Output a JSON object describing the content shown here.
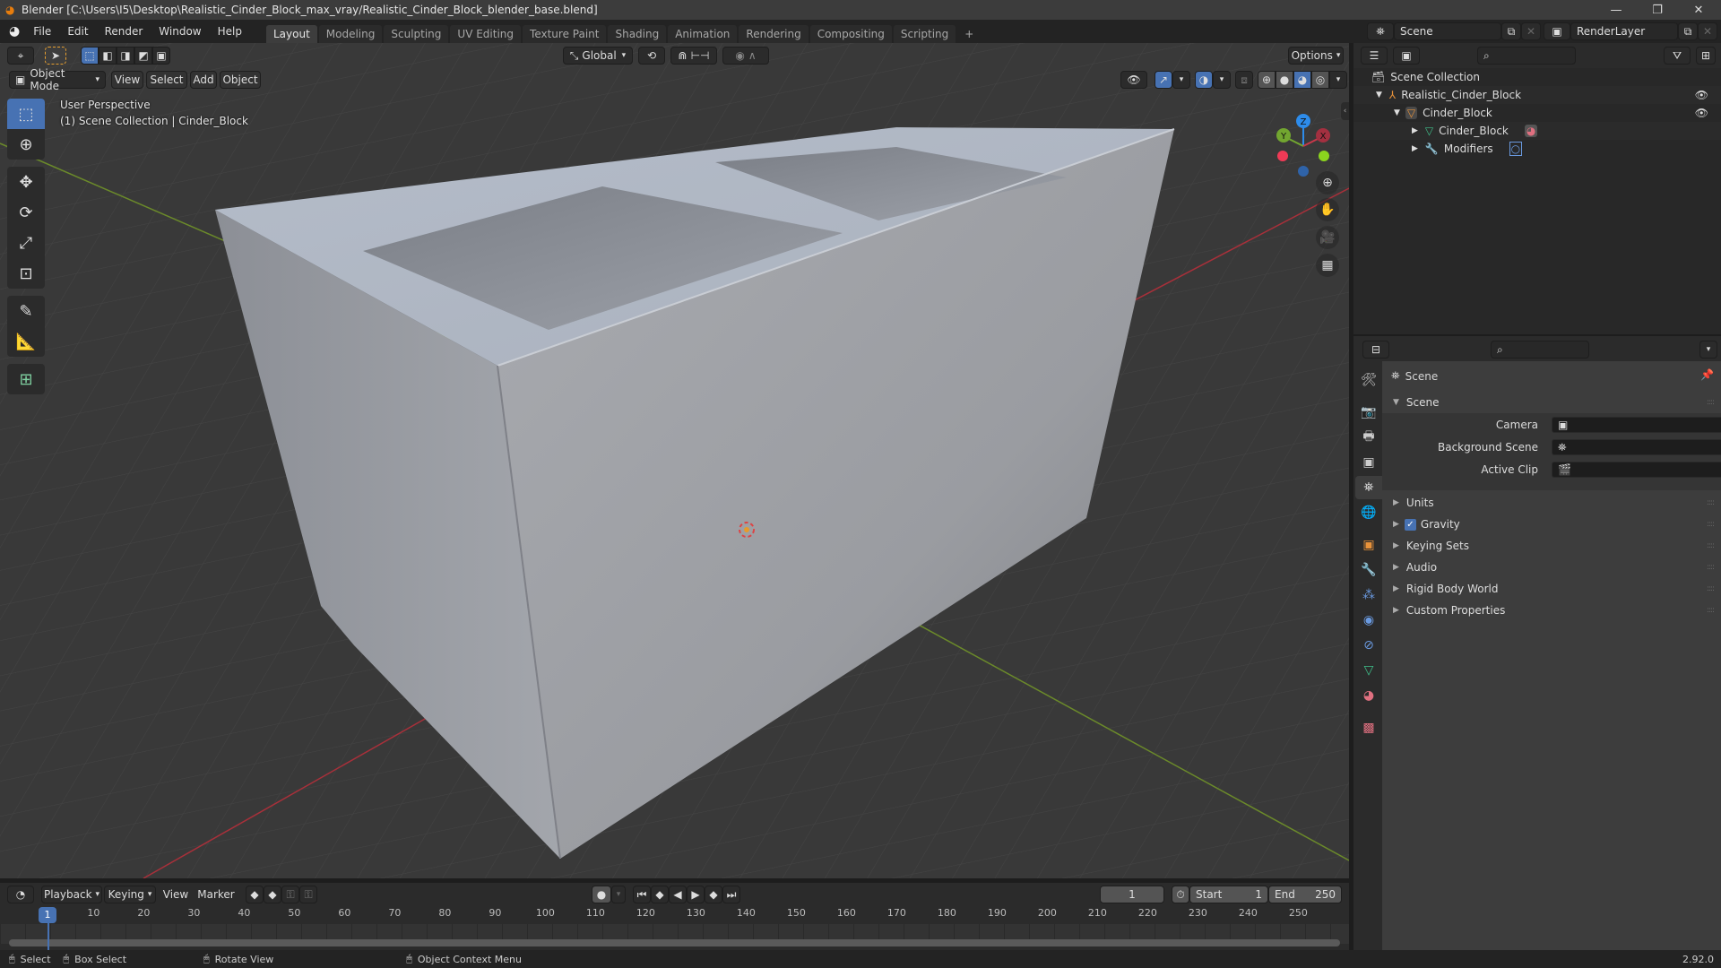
{
  "window": {
    "title": "Blender [C:\\Users\\I5\\Desktop\\Realistic_Cinder_Block_max_vray/Realistic_Cinder_Block_blender_base.blend]",
    "controls": {
      "minimize": "—",
      "maximize": "❐",
      "close": "✕"
    }
  },
  "menu": [
    "File",
    "Edit",
    "Render",
    "Window",
    "Help"
  ],
  "workspaces": {
    "tabs": [
      "Layout",
      "Modeling",
      "Sculpting",
      "UV Editing",
      "Texture Paint",
      "Shading",
      "Animation",
      "Rendering",
      "Compositing",
      "Scripting"
    ],
    "active": "Layout",
    "add_label": "+"
  },
  "scene_selector": {
    "scene": "Scene",
    "view_layer": "RenderLayer"
  },
  "viewport": {
    "transform_orientation": "Global",
    "options_label": "Options",
    "mode": "Object Mode",
    "header_menu": [
      "View",
      "Select",
      "Add",
      "Object"
    ],
    "overlay_line1": "User Perspective",
    "overlay_line2": "(1) Scene Collection | Cinder_Block",
    "gizmo_axes": {
      "x": "X",
      "y": "Y",
      "z": "Z"
    },
    "axis_colors": {
      "x": "#c8384a",
      "y": "#72a630",
      "z": "#2d8ceb"
    },
    "shading_active": "material-preview"
  },
  "outliner": {
    "root": "Scene Collection",
    "items": [
      {
        "label": "Realistic_Cinder_Block",
        "type": "collection",
        "expanded": true,
        "visible": true
      },
      {
        "label": "Cinder_Block",
        "type": "object",
        "expanded": true,
        "visible": true
      },
      {
        "label": "Cinder_Block",
        "type": "mesh-data",
        "expanded": false
      },
      {
        "label": "Modifiers",
        "type": "modifiers",
        "expanded": false
      }
    ]
  },
  "properties": {
    "context_label": "Scene",
    "panel_title": "Scene",
    "fields": [
      {
        "label": "Camera",
        "value": ""
      },
      {
        "label": "Background Scene",
        "value": ""
      },
      {
        "label": "Active Clip",
        "value": ""
      }
    ],
    "subpanels": [
      {
        "label": "Units"
      },
      {
        "label": "Gravity",
        "checkbox": true,
        "checked": true
      },
      {
        "label": "Keying Sets"
      },
      {
        "label": "Audio"
      },
      {
        "label": "Rigid Body World"
      },
      {
        "label": "Custom Properties"
      }
    ]
  },
  "timeline": {
    "menus": [
      "Playback",
      "Keying",
      "View",
      "Marker"
    ],
    "current_frame": "1",
    "start_label": "Start",
    "start": "1",
    "end_label": "End",
    "end": "250",
    "ticks": [
      "10",
      "20",
      "30",
      "40",
      "50",
      "60",
      "70",
      "80",
      "90",
      "100",
      "110",
      "120",
      "130",
      "140",
      "150",
      "160",
      "170",
      "180",
      "190",
      "200",
      "210",
      "220",
      "230",
      "240",
      "250"
    ]
  },
  "statusbar": {
    "hints": [
      "Select",
      "Box Select",
      "Rotate View",
      "Object Context Menu"
    ],
    "version": "2.92.0"
  }
}
